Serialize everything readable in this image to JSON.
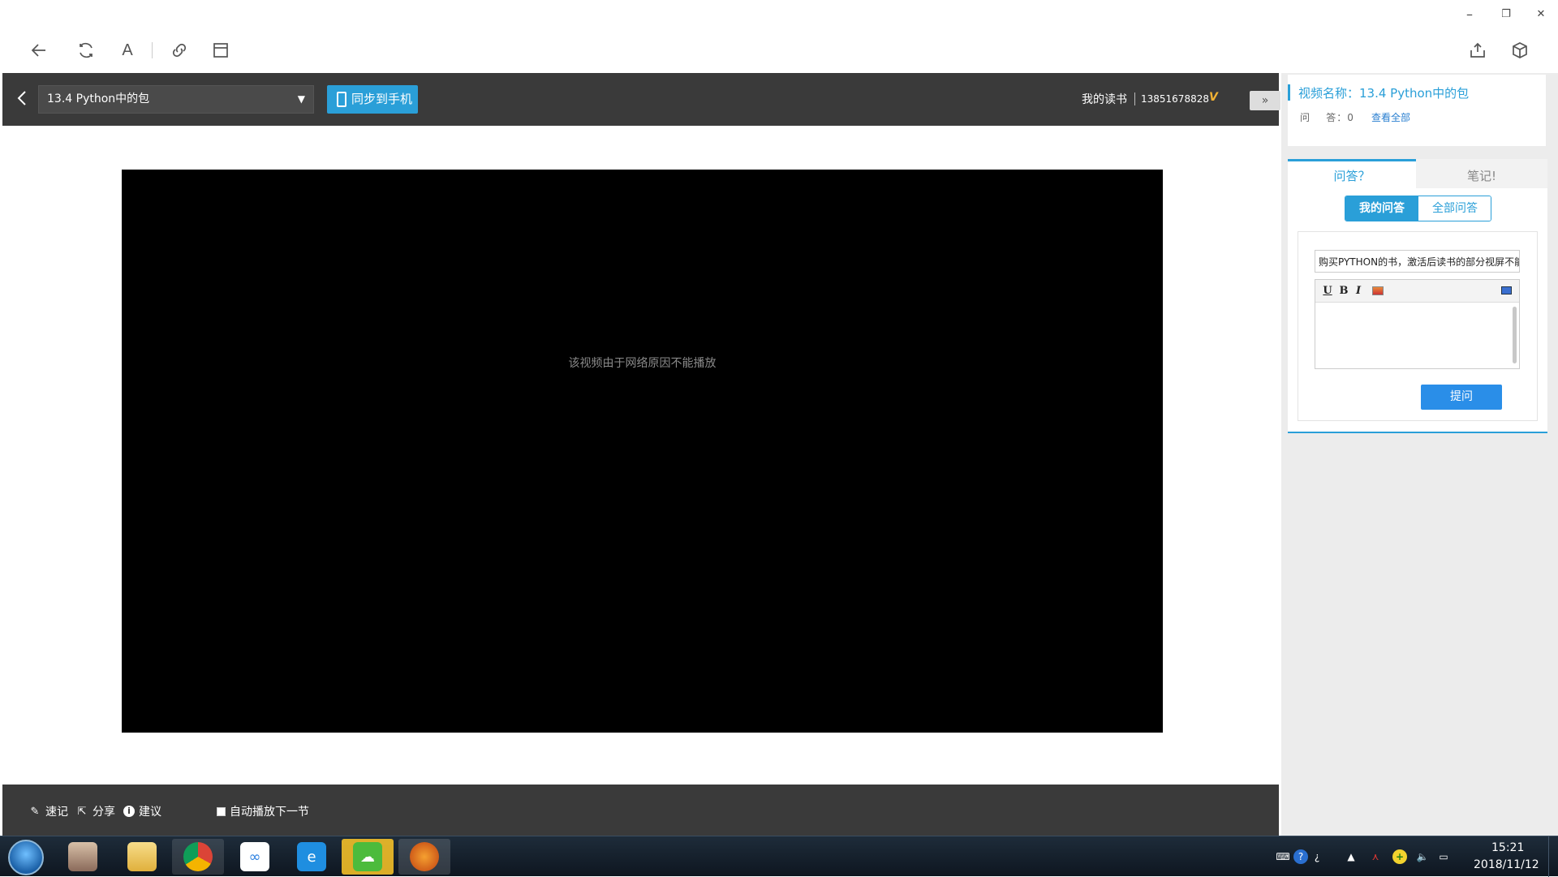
{
  "window": {
    "minimize": "–",
    "restore": "❐",
    "close": "✕"
  },
  "toolbar": {
    "font_label": "A"
  },
  "reader": {
    "chapter_select": "13.4 Python中的包",
    "sync_label": "同步到手机",
    "my_reading": "我的读书",
    "user_phone": "13851678828",
    "collapse_label": "»",
    "video_message": "该视频由于网络原因不能播放",
    "footer": {
      "note": "速记",
      "share": "分享",
      "suggest": "建议",
      "autoplay": "自动播放下一节"
    }
  },
  "sidebar": {
    "video_name": "视频名称：13.4 Python中的包",
    "qa_count": "问    答：0",
    "view_all": "查看全部",
    "tabs": {
      "qa": "问答？",
      "notes": "笔记!"
    },
    "sub_tabs": {
      "mine": "我的问答",
      "all": "全部问答"
    },
    "question_title": "购买PYTHON的书，激活后读书的部分视屏不能",
    "editor_buttons": {
      "underline": "U",
      "bold": "B",
      "italic": "I"
    },
    "ask_button": "提问"
  },
  "taskbar": {
    "time": "15:21",
    "date": "2018/11/12"
  },
  "colors": {
    "accent": "#2a9fd8",
    "dark_bar": "#3a3a3a",
    "video_bg": "#000000"
  }
}
